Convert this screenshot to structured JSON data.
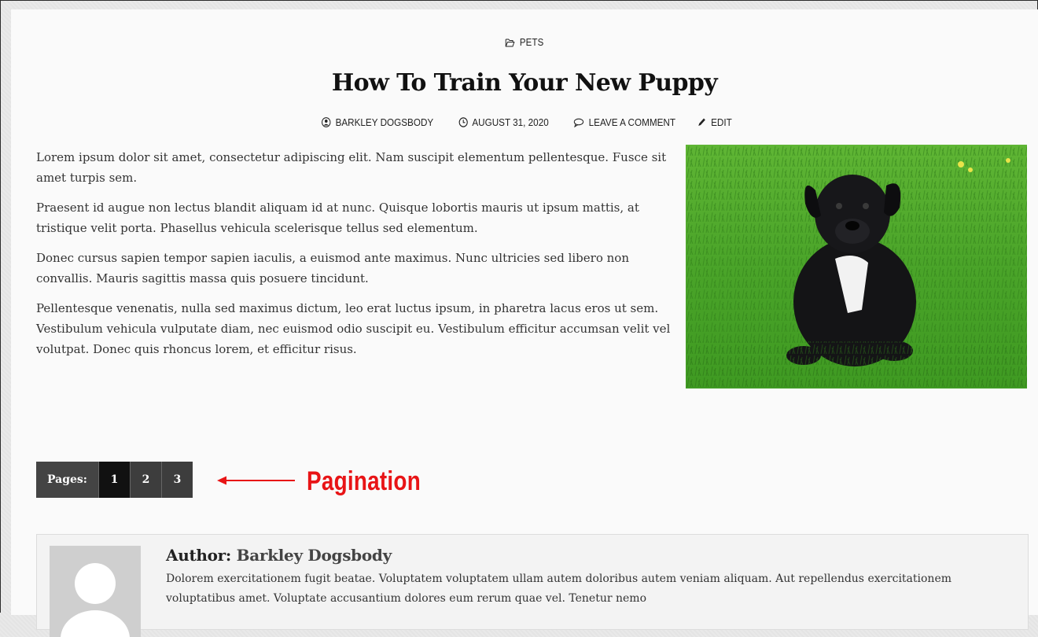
{
  "category": "PETS",
  "post": {
    "title": "How To Train Your New Puppy",
    "meta": {
      "author": "BARKLEY DOGSBODY",
      "date": "AUGUST 31, 2020",
      "comment": "LEAVE A COMMENT",
      "edit": "EDIT"
    },
    "paragraphs": [
      "Lorem ipsum dolor sit amet, consectetur adipiscing elit. Nam suscipit elementum pellentesque. Fusce sit amet turpis sem.",
      "Praesent id augue non lectus blandit aliquam id at nunc. Quisque lobortis mauris ut ipsum mattis, at tristique velit porta. Phasellus vehicula scelerisque tellus sed elementum.",
      "Donec cursus sapien tempor sapien iaculis, a euismod ante maximus. Nunc ultricies sed libero non convallis. Mauris sagittis massa quis posuere tincidunt.",
      "Pellentesque venenatis, nulla sed maximus dictum, leo erat luctus ipsum, in pharetra lacus eros ut sem. Vestibulum vehicula vulputate diam, nec euismod odio suscipit eu. Vestibulum efficitur accumsan velit vel volutpat. Donec quis rhoncus lorem, et efficitur risus."
    ]
  },
  "pagination": {
    "label": "Pages:",
    "pages": [
      "1",
      "2",
      "3"
    ],
    "current": "1"
  },
  "annotation": {
    "text": "Pagination",
    "color": "#e81416"
  },
  "author_box": {
    "prefix": "Author:",
    "name": "Barkley Dogsbody",
    "bio": "Dolorem exercitationem fugit beatae. Voluptatem voluptatem ullam autem doloribus autem veniam aliquam. Aut repellendus exercitationem voluptatibus amet. Voluptate accusantium dolores eum rerum quae vel. Tenetur nemo"
  },
  "icons": {
    "category": "folder-open-icon",
    "author": "user-circle-icon",
    "date": "clock-icon",
    "comment": "comment-icon",
    "edit": "pencil-icon"
  }
}
